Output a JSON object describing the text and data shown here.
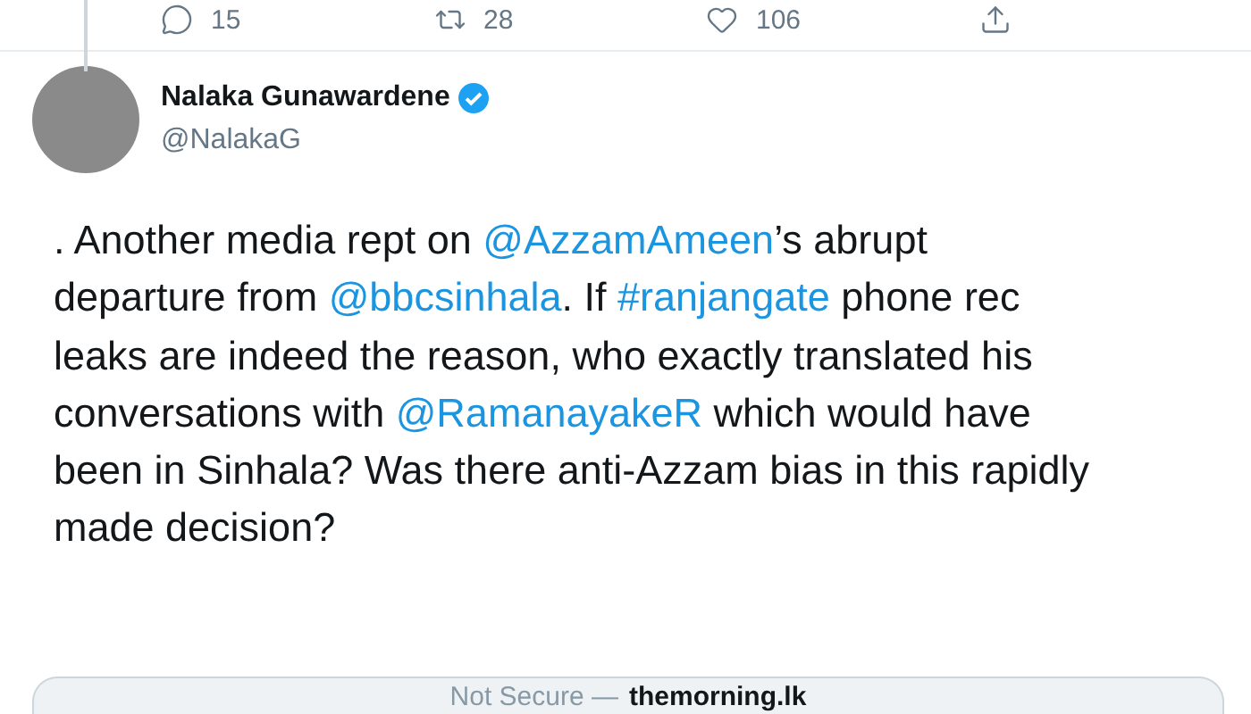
{
  "actions": [
    {
      "kind": "reply",
      "count": "15"
    },
    {
      "kind": "retweet",
      "count": "28"
    },
    {
      "kind": "like",
      "count": "106"
    },
    {
      "kind": "share"
    }
  ],
  "author": {
    "name": "Nalaka Gunawardene",
    "verified": true,
    "handle": "@NalakaG"
  },
  "body": [
    {
      "text": ". Another media rept on ",
      "link": false
    },
    {
      "text": "@AzzamAmeen",
      "link": true
    },
    {
      "text": "’s abrupt departure from ",
      "link": false
    },
    {
      "text": "@bbcsinhala",
      "link": true
    },
    {
      "text": ". If ",
      "link": false
    },
    {
      "text": "#ranjangate",
      "link": true
    },
    {
      "text": " phone rec leaks are indeed the reason, who exactly translated his conversations with ",
      "link": false
    },
    {
      "text": "@RamanayakeR",
      "link": true
    },
    {
      "text": " which would have been in Sinhala? Was there anti-Azzam bias in this rapidly made decision?",
      "link": false
    }
  ],
  "link_card": {
    "security": "Not Secure",
    "separator": "—",
    "domain": "themorning.lk"
  }
}
